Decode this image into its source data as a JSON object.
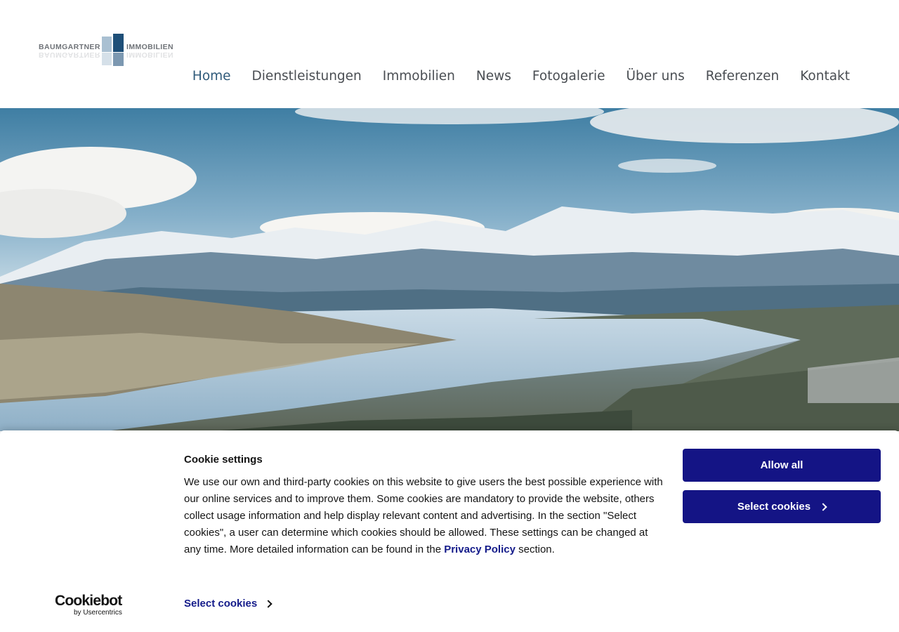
{
  "logo": {
    "text_left": "BAUMGARTNER",
    "text_right": "IMMOBILIEN"
  },
  "nav": {
    "items": [
      {
        "label": "Home",
        "active": true
      },
      {
        "label": "Dienstleistungen"
      },
      {
        "label": "Immobilien"
      },
      {
        "label": "News"
      },
      {
        "label": "Fotogalerie"
      },
      {
        "label": "Über uns"
      },
      {
        "label": "Referenzen"
      },
      {
        "label": "Kontakt"
      }
    ]
  },
  "cookie": {
    "title": "Cookie settings",
    "text_before_link": "We use our own and third-party cookies on this website to give users the best possible experience with our online services and to improve them. Some cookies are mandatory to provide the website, others collect usage information and help display relevant content and advertising. In the section \"Select cookies\", a user can determine which cookies should be allowed. These settings can be changed at any time. More detailed information can be found in the ",
    "link": "Privacy Policy",
    "text_after_link": " section.",
    "allow_all": "Allow all",
    "select_cookies_button": "Select cookies",
    "select_cookies_link": "Select cookies",
    "brand": "Cookiebot",
    "brand_sub": "by Usercentrics"
  },
  "colors": {
    "nav_active": "#2f5a7a",
    "button": "#141485",
    "link": "#141b8a"
  }
}
